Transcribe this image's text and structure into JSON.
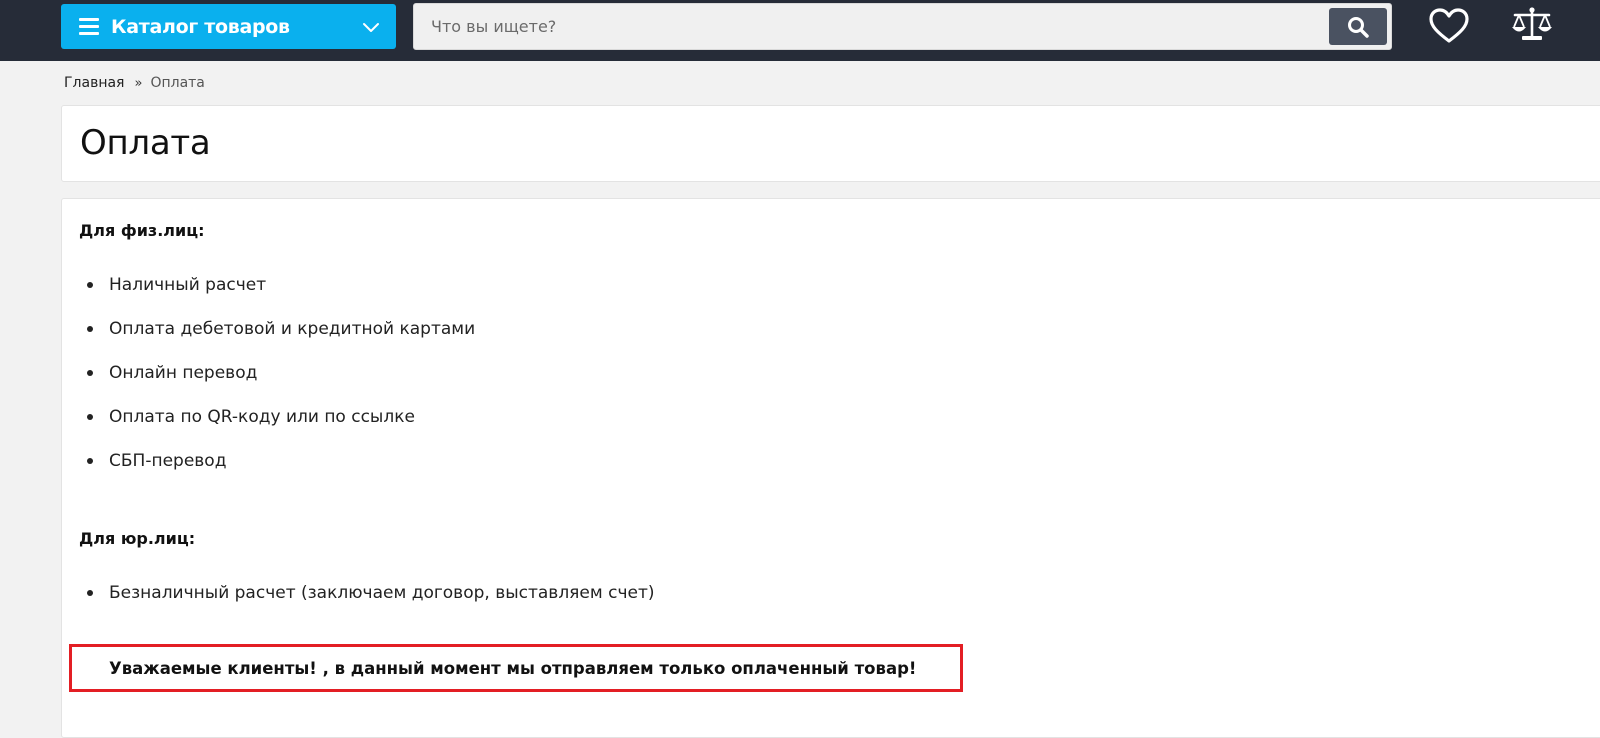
{
  "header": {
    "catalog_label": "Каталог товаров",
    "search_placeholder": "Что вы ищете?",
    "search_value": "",
    "icons": [
      "menu-icon",
      "chevron-down-icon",
      "search-icon",
      "heart-icon",
      "scales-icon"
    ],
    "colors": {
      "topbar": "#262c38",
      "catalog": "#0ab0ee",
      "search_button": "#4a5261"
    }
  },
  "breadcrumb": {
    "home": "Главная",
    "separator": "»",
    "current": "Оплата"
  },
  "page": {
    "title": "Оплата",
    "individuals": {
      "heading": "Для физ.лиц:",
      "items": [
        "Наличный расчет",
        "Оплата дебетовой и кредитной картами",
        "Онлайн перевод",
        "Оплата по QR-коду или по ссылке",
        "СБП-перевод"
      ]
    },
    "companies": {
      "heading": "Для юр.лиц:",
      "items": [
        "Безналичный расчет (заключаем договор, выставляем счет)"
      ]
    },
    "notice": "Уважаемые клиенты! , в данный момент мы отправляем только оплаченный товар!",
    "notice_border_color": "#e31e24"
  }
}
